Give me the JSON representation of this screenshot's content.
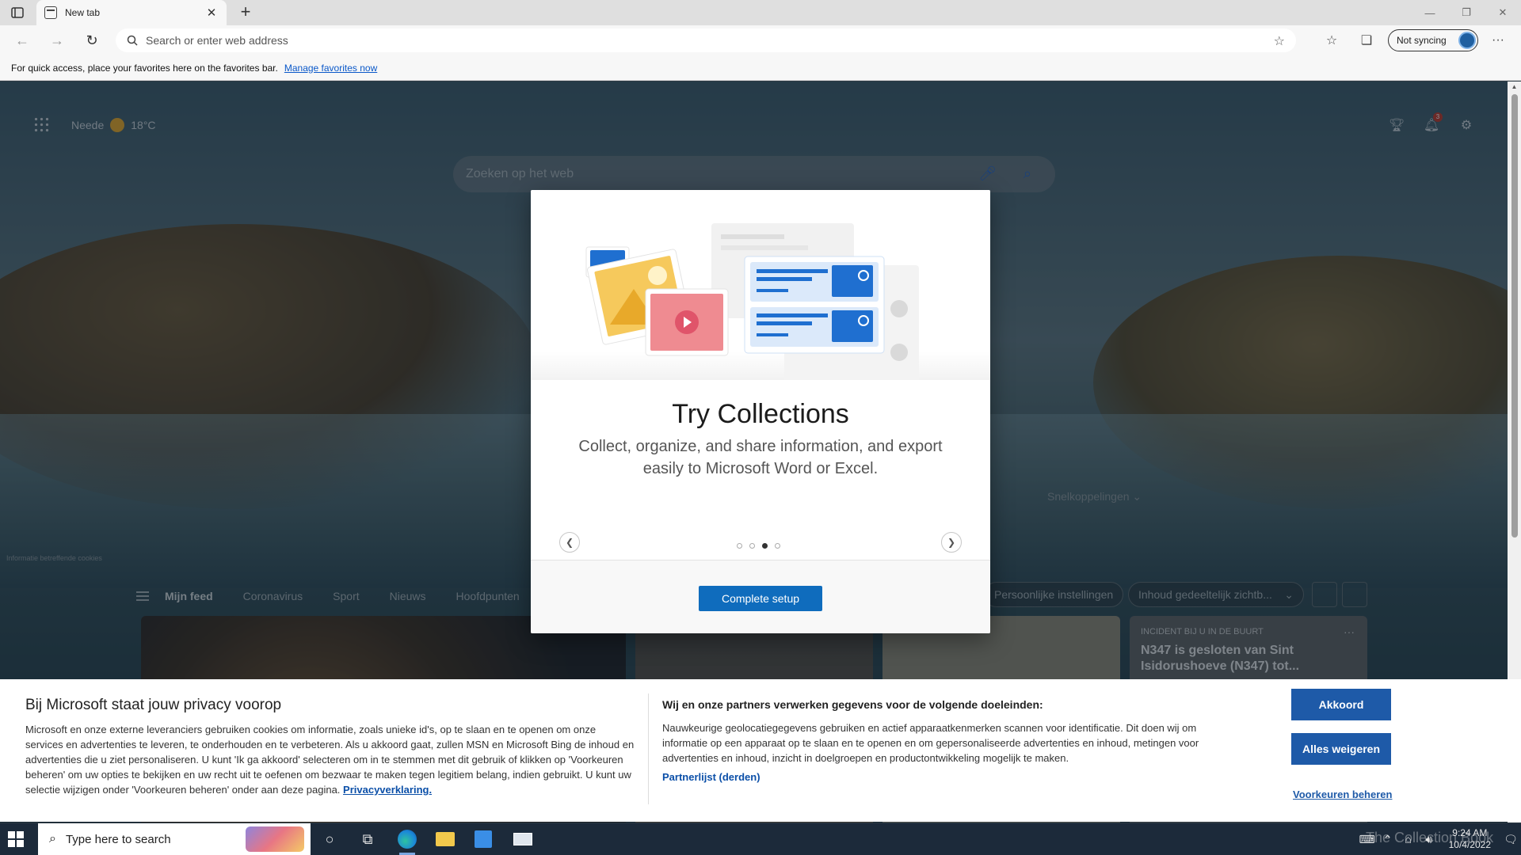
{
  "browser": {
    "tab_title": "New tab",
    "address_placeholder": "Search or enter web address",
    "sync_label": "Not syncing",
    "favbar_text": "For quick access, place your favorites here on the favorites bar.",
    "favbar_link": "Manage favorites now"
  },
  "ntp": {
    "location": "Neede",
    "temperature": "18°C",
    "notification_count": "3",
    "search_placeholder": "Zoeken op het web",
    "quicklinks_label": "Snelkoppelingen",
    "cookie_info": "Informatie betreffende cookies",
    "feed_tabs": [
      "Mijn feed",
      "Coronavirus",
      "Sport",
      "Nieuws",
      "Hoofdpunten"
    ],
    "personal_settings": "Persoonlijke instellingen",
    "content_visibility": "Inhoud gedeeltelijk zichtb...",
    "news_card": {
      "tag": "INCIDENT BIJ U IN DE BUURT",
      "title": "N347 is gesloten van Sint Isidorushoeve (N347) tot..."
    }
  },
  "modal": {
    "title": "Try Collections",
    "description": "Collect, organize, and share information, and export easily to Microsoft Word or Excel.",
    "button_label": "Complete setup",
    "page_count": 4,
    "active_page": 3
  },
  "consent": {
    "title": "Bij Microsoft staat jouw privacy voorop",
    "body": "Microsoft en onze externe leveranciers gebruiken cookies om informatie, zoals unieke id's, op te slaan en te openen om onze services en advertenties te leveren, te onderhouden en te verbeteren. Als u akkoord gaat, zullen MSN en Microsoft Bing de inhoud en advertenties die u ziet personaliseren. U kunt 'Ik ga akkoord' selecteren om in te stemmen met dit gebruik of klikken op 'Voorkeuren beheren' om uw opties te bekijken en uw recht uit te oefenen om bezwaar te maken tegen legitiem belang, indien gebruikt. U kunt uw selectie wijzigen onder 'Voorkeuren beheren' onder aan deze pagina.",
    "privacy_link": "Privacyverklaring.",
    "purposes_title": "Wij en onze partners verwerken gegevens voor de volgende doeleinden:",
    "purposes_body": "Nauwkeurige geolocatiegegevens gebruiken en actief apparaatkenmerken scannen voor identificatie. Dit doen wij om informatie op een apparaat op te slaan en te openen en om gepersonaliseerde advertenties en inhoud, metingen voor advertenties en inhoud, inzicht in doelgroepen en productontwikkeling mogelijk te maken.",
    "partner_link": "Partnerlijst (derden)",
    "accept_label": "Akkoord",
    "reject_label": "Alles weigeren",
    "manage_label": "Voorkeuren beheren"
  },
  "taskbar": {
    "search_placeholder": "Type here to search",
    "time": "9:24 AM",
    "date": "10/4/2022",
    "watermark": "The Collection Book"
  },
  "colors": {
    "accent": "#0f6cbd",
    "consent_button": "#1e5aa8",
    "taskbar": "#1c2a3a"
  }
}
